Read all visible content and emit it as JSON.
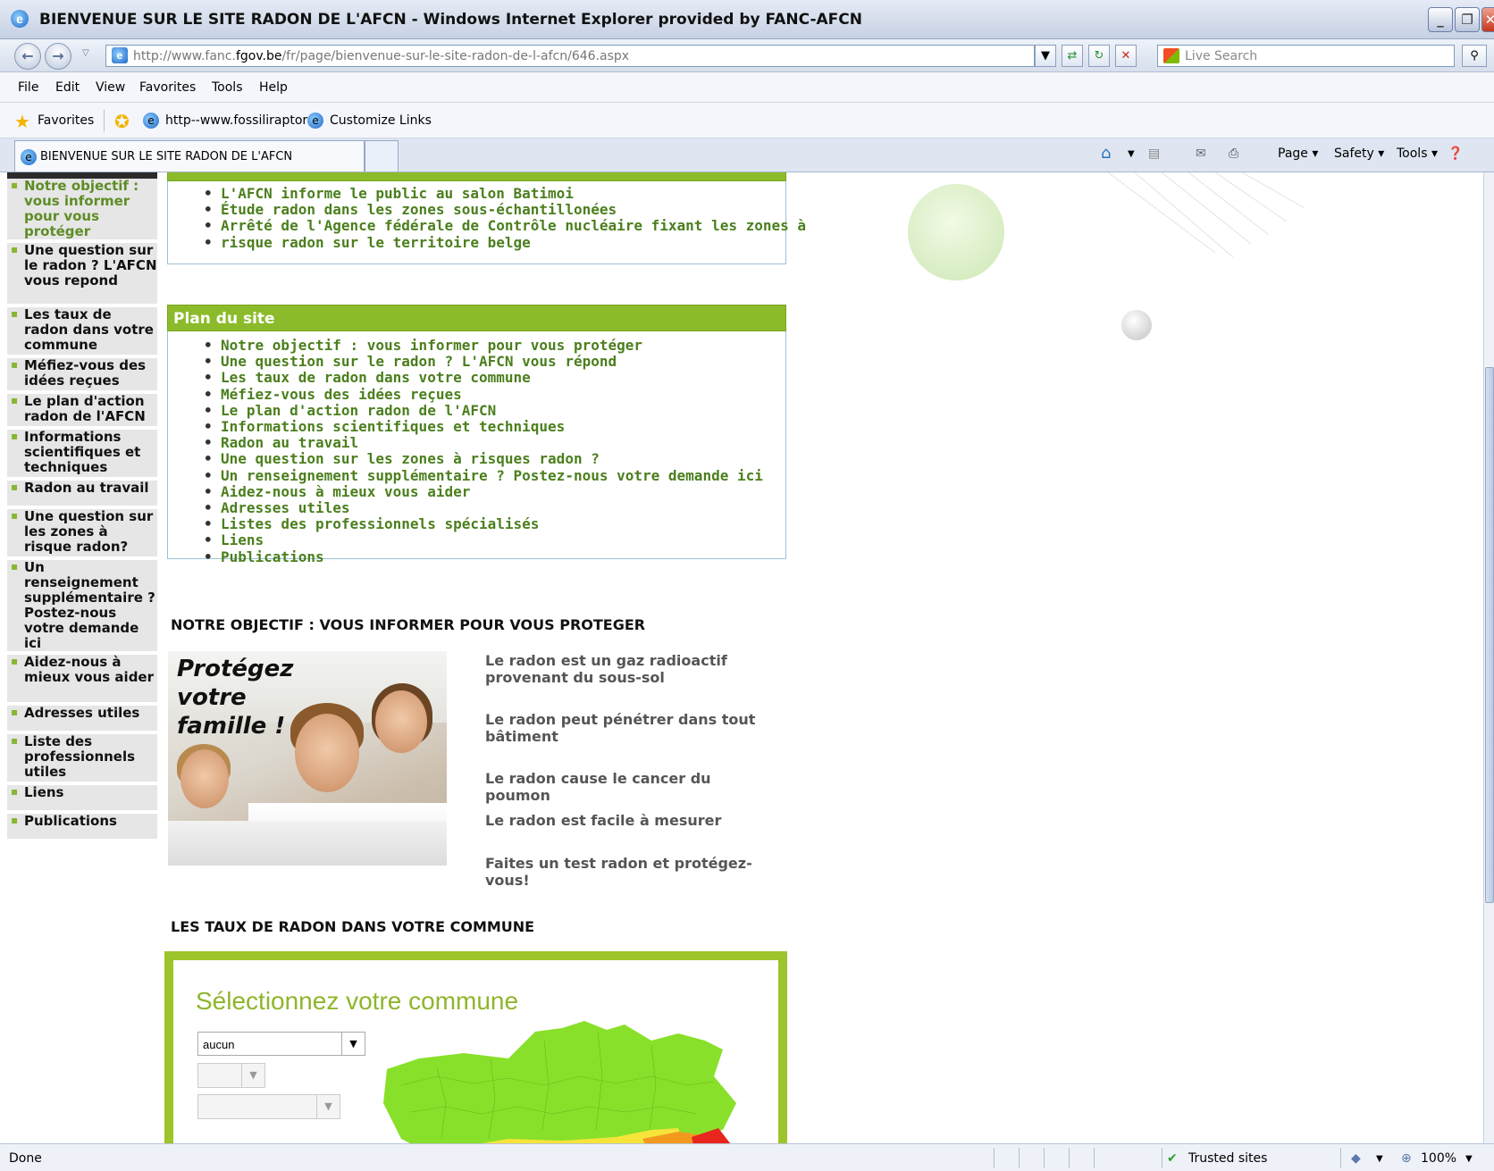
{
  "window": {
    "title": "BIENVENUE SUR LE SITE RADON DE L'AFCN - Windows Internet Explorer provided by FANC-AFCN",
    "minimize": "_",
    "restore": "❐",
    "close": "✕"
  },
  "address": {
    "url_prefix": "http://www.fanc.",
    "url_domain": "fgov.be",
    "url_suffix": "/fr/page/bienvenue-sur-le-site-radon-de-l-afcn/646.aspx",
    "search_placeholder": "Live Search"
  },
  "menu": [
    "File",
    "Edit",
    "View",
    "Favorites",
    "Tools",
    "Help"
  ],
  "favorites": {
    "label": "Favorites",
    "links": [
      "http--www.fossiliraptor",
      "Customize Links"
    ]
  },
  "tabs": {
    "active": "BIENVENUE SUR LE SITE RADON DE L'AFCN"
  },
  "commands": [
    "Page ▾",
    "Safety ▾",
    "Tools ▾"
  ],
  "sidebar": {
    "items": [
      "Notre objectif : vous informer pour vous protéger",
      "Une question sur le radon ? L'AFCN vous repond",
      "Les taux de radon dans votre commune",
      "Méfiez-vous des idées reçues",
      "Le plan d'action radon de l'AFCN",
      "Informations scientifiques et techniques",
      "Radon au travail",
      "Une question sur les zones à risque radon?",
      "Un renseignement supplémentaire ? Postez-nous votre demande ici",
      "Aidez-nous à mieux vous aider",
      "Adresses utiles",
      "Liste des professionnels utiles",
      "Liens",
      "Publications"
    ]
  },
  "news": {
    "items": [
      "L'AFCN informe le public au salon Batimoi",
      "Étude radon dans les zones sous-échantillonées",
      "Arrêté de l'Agence fédérale de Contrôle nucléaire fixant les zones à",
      "risque radon sur le territoire belge"
    ]
  },
  "sitemap": {
    "title": "Plan du site",
    "items": [
      "Notre objectif : vous informer pour vous protéger",
      "Une question sur le radon ? L'AFCN vous répond",
      "Les taux de radon dans votre commune",
      "Méfiez-vous des idées reçues",
      "Le plan d'action radon de l'AFCN",
      "Informations scientifiques et techniques",
      "Radon au travail",
      "Une question sur les zones à risques radon ?",
      "Un renseignement supplémentaire ? Postez-nous votre demande ici",
      "Aidez-nous à mieux vous aider",
      "Adresses utiles",
      "Listes des professionnels spécialisés",
      "Liens",
      "Publications"
    ]
  },
  "objective": {
    "heading": "NOTRE OBJECTIF : VOUS INFORMER POUR VOUS PROTEGER",
    "photo_caption": [
      "Protégez",
      "votre",
      "famille !"
    ],
    "facts": [
      "Le radon est un gaz radioactif provenant du sous-sol",
      "Le radon peut pénétrer dans tout bâtiment",
      "Le radon cause le cancer du poumon",
      "Le radon est facile à mesurer",
      "Faites un test radon et protégez-vous!"
    ]
  },
  "commune": {
    "heading": "LES TAUX DE RADON DANS VOTRE COMMUNE",
    "title": "Sélectionnez votre commune",
    "select_value": "aucun",
    "map_colors": {
      "low": "#88e02a",
      "mid": "#f7e43a",
      "high": "#e8261d",
      "orange": "#f39a1e"
    }
  },
  "status": {
    "text": "Done",
    "zone": "Trusted sites",
    "zoom": "100%"
  }
}
